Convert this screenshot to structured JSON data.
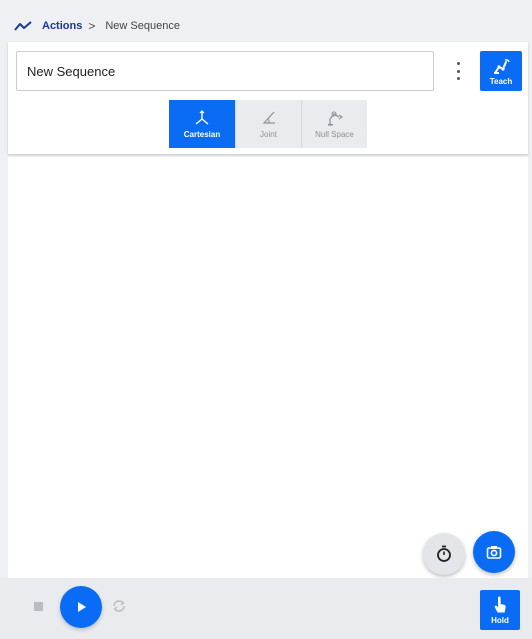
{
  "breadcrumb": {
    "icon": "trend-line-icon",
    "parent": "Actions",
    "separator": ">",
    "current": "New Sequence"
  },
  "sequence": {
    "name_value": "New Sequence",
    "menu_icon": "more-vertical-icon"
  },
  "teach": {
    "label": "Teach",
    "icon": "robot-arm-icon"
  },
  "modes": [
    {
      "label": "Cartesian",
      "icon": "axes-icon",
      "active": true
    },
    {
      "label": "Joint",
      "icon": "angle-icon",
      "active": false
    },
    {
      "label": "Null Space",
      "icon": "robot-arm-outline-icon",
      "active": false
    }
  ],
  "fabs": {
    "timer_icon": "stopwatch-icon",
    "camera_icon": "camera-icon"
  },
  "playback": {
    "stop_icon": "stop-icon",
    "play_icon": "play-icon",
    "loop_icon": "loop-icon"
  },
  "hold": {
    "label": "Hold",
    "icon": "hand-pointer-icon"
  },
  "colors": {
    "accent": "#0a6cf5",
    "breadcrumb": "#1d3a8a",
    "background": "#eef0f3"
  }
}
